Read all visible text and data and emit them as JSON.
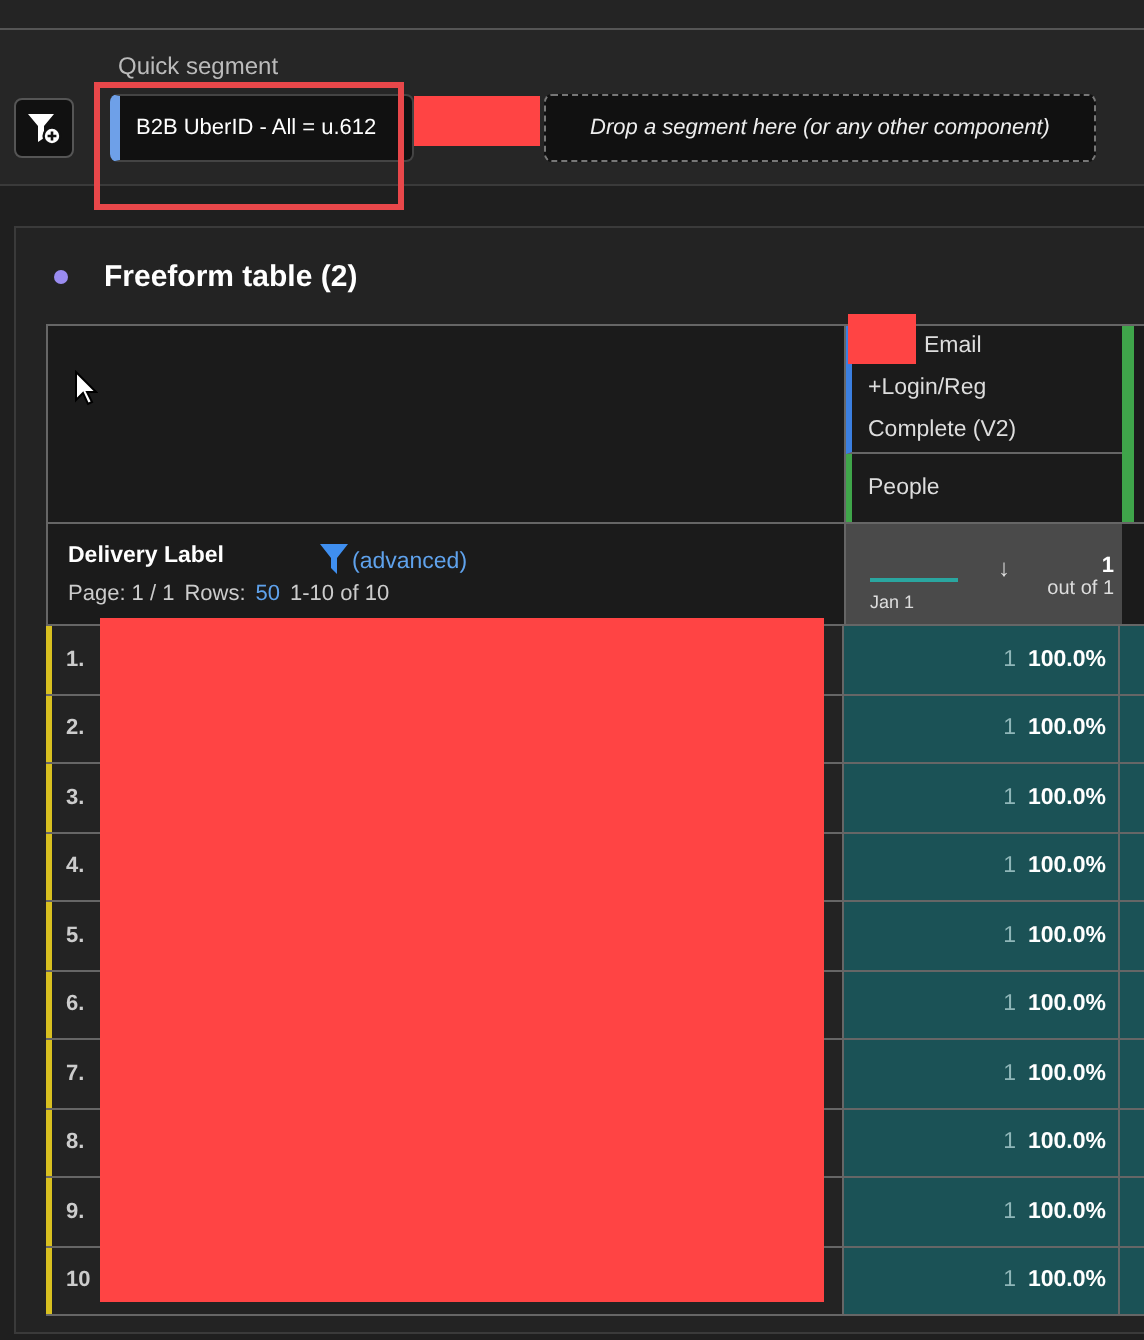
{
  "segment_bar": {
    "label": "Quick segment",
    "segment": "B2B UberID - All = u.612",
    "drop_placeholder": "Drop a segment here (or any other component)"
  },
  "panel": {
    "title": "Freeform table (2)",
    "table": {
      "metric": {
        "title_lines": [
          "Email",
          "+Login/Reg",
          "Complete (V2)"
        ],
        "subtitle": "People"
      },
      "dimension": {
        "title": "Delivery Label",
        "filter_link": "(advanced)",
        "page_label": "Page: 1 / 1",
        "rows_label": "Rows:",
        "rows_value": "50",
        "range": "1-10 of 10"
      },
      "summary": {
        "date": "Jan 1",
        "sort_arrow": "↓",
        "total": "1",
        "total_note": "out of 1"
      },
      "rows": [
        {
          "label": "1.",
          "count": "1",
          "percent": "100.0%"
        },
        {
          "label": "2.",
          "count": "1",
          "percent": "100.0%"
        },
        {
          "label": "3.",
          "count": "1",
          "percent": "100.0%"
        },
        {
          "label": "4.",
          "count": "1",
          "percent": "100.0%"
        },
        {
          "label": "5.",
          "count": "1",
          "percent": "100.0%"
        },
        {
          "label": "6.",
          "count": "1",
          "percent": "100.0%"
        },
        {
          "label": "7.",
          "count": "1",
          "percent": "100.0%"
        },
        {
          "label": "8.",
          "count": "1",
          "percent": "100.0%"
        },
        {
          "label": "9.",
          "count": "1",
          "percent": "100.0%"
        },
        {
          "label": "10",
          "count": "1",
          "percent": "100.0%"
        }
      ]
    }
  }
}
